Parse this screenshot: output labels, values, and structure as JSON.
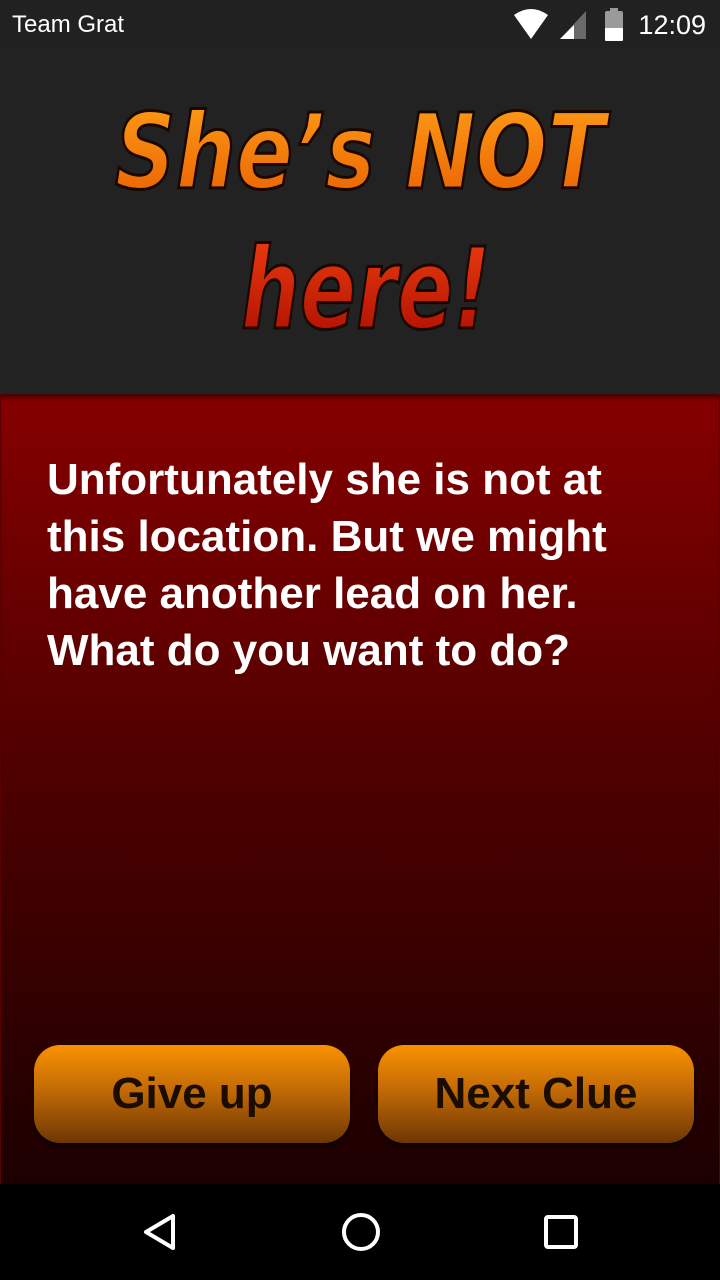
{
  "status_bar": {
    "carrier": "Team Grat",
    "time": "12:09",
    "icons": [
      "wifi-icon",
      "cell-signal-icon",
      "battery-icon"
    ]
  },
  "header": {
    "title_line1": "She’s NOT",
    "title_line2": "here!",
    "colors": {
      "line1_top": "#ffa018",
      "line1_bottom": "#e85c00",
      "line2_top": "#f04010",
      "line2_bottom": "#a80a00",
      "outline": "#1a0800",
      "background": "#222222"
    }
  },
  "content": {
    "message": "Unfortunately she is not at this location. But we might have another lead on her. What do you want to do?",
    "colors": {
      "panel_top": "#860000",
      "panel_bottom": "#1c0000",
      "text": "#ffffff"
    }
  },
  "actions": {
    "give_up_label": "Give up",
    "next_clue_label": "Next Clue",
    "button_color": "#f99100"
  },
  "nav_bar": {
    "icons": [
      "back-triangle-icon",
      "home-circle-icon",
      "recents-square-icon"
    ]
  }
}
